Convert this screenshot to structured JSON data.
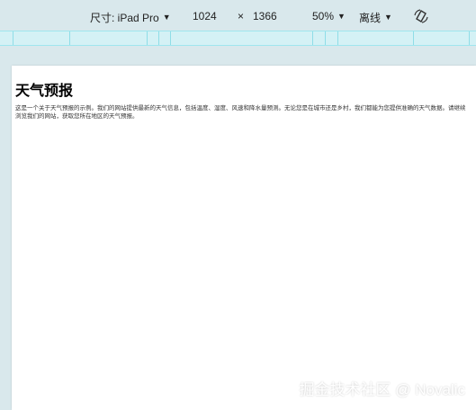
{
  "toolbar": {
    "size_label": "尺寸: iPad Pro",
    "width": "1024",
    "times": "×",
    "height": "1366",
    "zoom": "50%",
    "network": "离线",
    "rotate_icon": "rotate-icon"
  },
  "page": {
    "title": "天气预报",
    "paragraph": "这是一个关于天气预报的示例。我们的网站提供最新的天气信息，包括温度、湿度、风速和降水量预测。无论您是在城市还是乡村，我们都能为您提供准确的天气数据。请继续浏览我们的网站，获取您所在地区的天气预报。"
  },
  "watermark": "掘金技术社区 @ Novalic"
}
